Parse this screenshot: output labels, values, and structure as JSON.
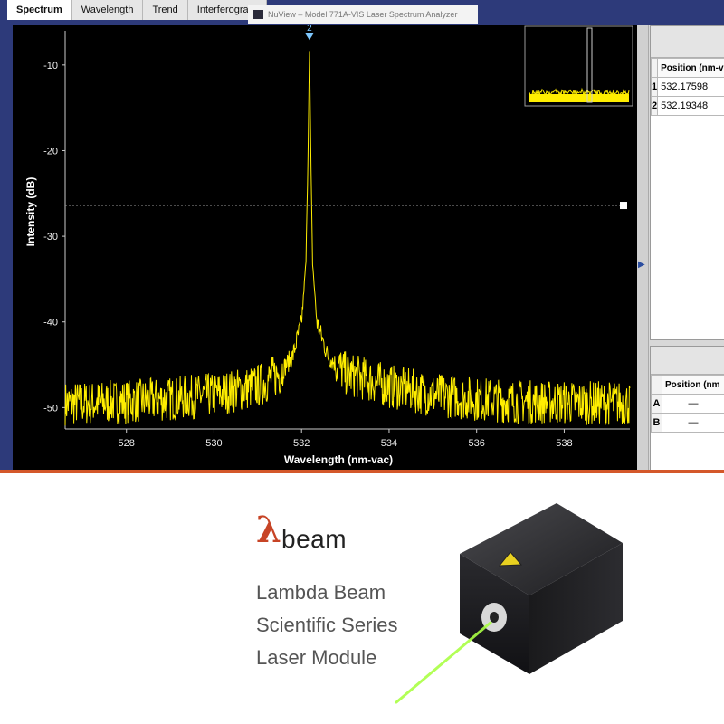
{
  "tabs": [
    "Spectrum",
    "Wavelength",
    "Trend",
    "Interferogram"
  ],
  "window_title": "NuView – Model 771A-VIS Laser Spectrum Analyzer",
  "chart_data": {
    "type": "line",
    "xlabel": "Wavelength (nm-vac)",
    "ylabel": "Intensity (dB)",
    "xlim": [
      526.6,
      539.5
    ],
    "ylim": [
      -52.5,
      -6
    ],
    "xticks": [
      528,
      530,
      532,
      534,
      536,
      538
    ],
    "yticks": [
      -10,
      -20,
      -30,
      -40,
      -50
    ],
    "threshold_dB": -26.4,
    "peak_marker": "2",
    "series": [
      {
        "x": [
          526.6,
          527.0,
          528.0,
          529.0,
          530.0,
          531.0,
          531.5,
          531.8,
          532.0,
          532.1,
          532.15,
          532.18,
          532.21,
          532.25,
          532.35,
          532.6,
          533.0,
          534.0,
          535.0,
          536.0,
          537.0,
          538.0,
          539.5
        ],
        "y": [
          -49.5,
          -49.5,
          -49.3,
          -49,
          -48.5,
          -47.5,
          -46,
          -44,
          -40,
          -33,
          -20,
          -7.5,
          -20,
          -33,
          -40,
          -44,
          -46,
          -47.5,
          -48.5,
          -49,
          -49.3,
          -49.4,
          -49.5
        ]
      }
    ]
  },
  "table1": {
    "col_header": "Position (nm-v",
    "rows": [
      {
        "idx": "1",
        "value": "532.17598"
      },
      {
        "idx": "2",
        "value": "532.19348"
      }
    ]
  },
  "table2": {
    "col_header": "Position (nm",
    "rows": [
      {
        "idx": "A",
        "value": "—"
      },
      {
        "idx": "B",
        "value": "—"
      }
    ]
  },
  "brand": {
    "logo_symbol": "λ",
    "logo_word": "beam",
    "line1": "Lambda Beam",
    "line2": "Scientific Series",
    "line3": "Laser Module"
  },
  "colors": {
    "trace": "#ffee00",
    "plot_bg": "#000000",
    "accent": "#c74426",
    "laser": "#aaff44"
  }
}
